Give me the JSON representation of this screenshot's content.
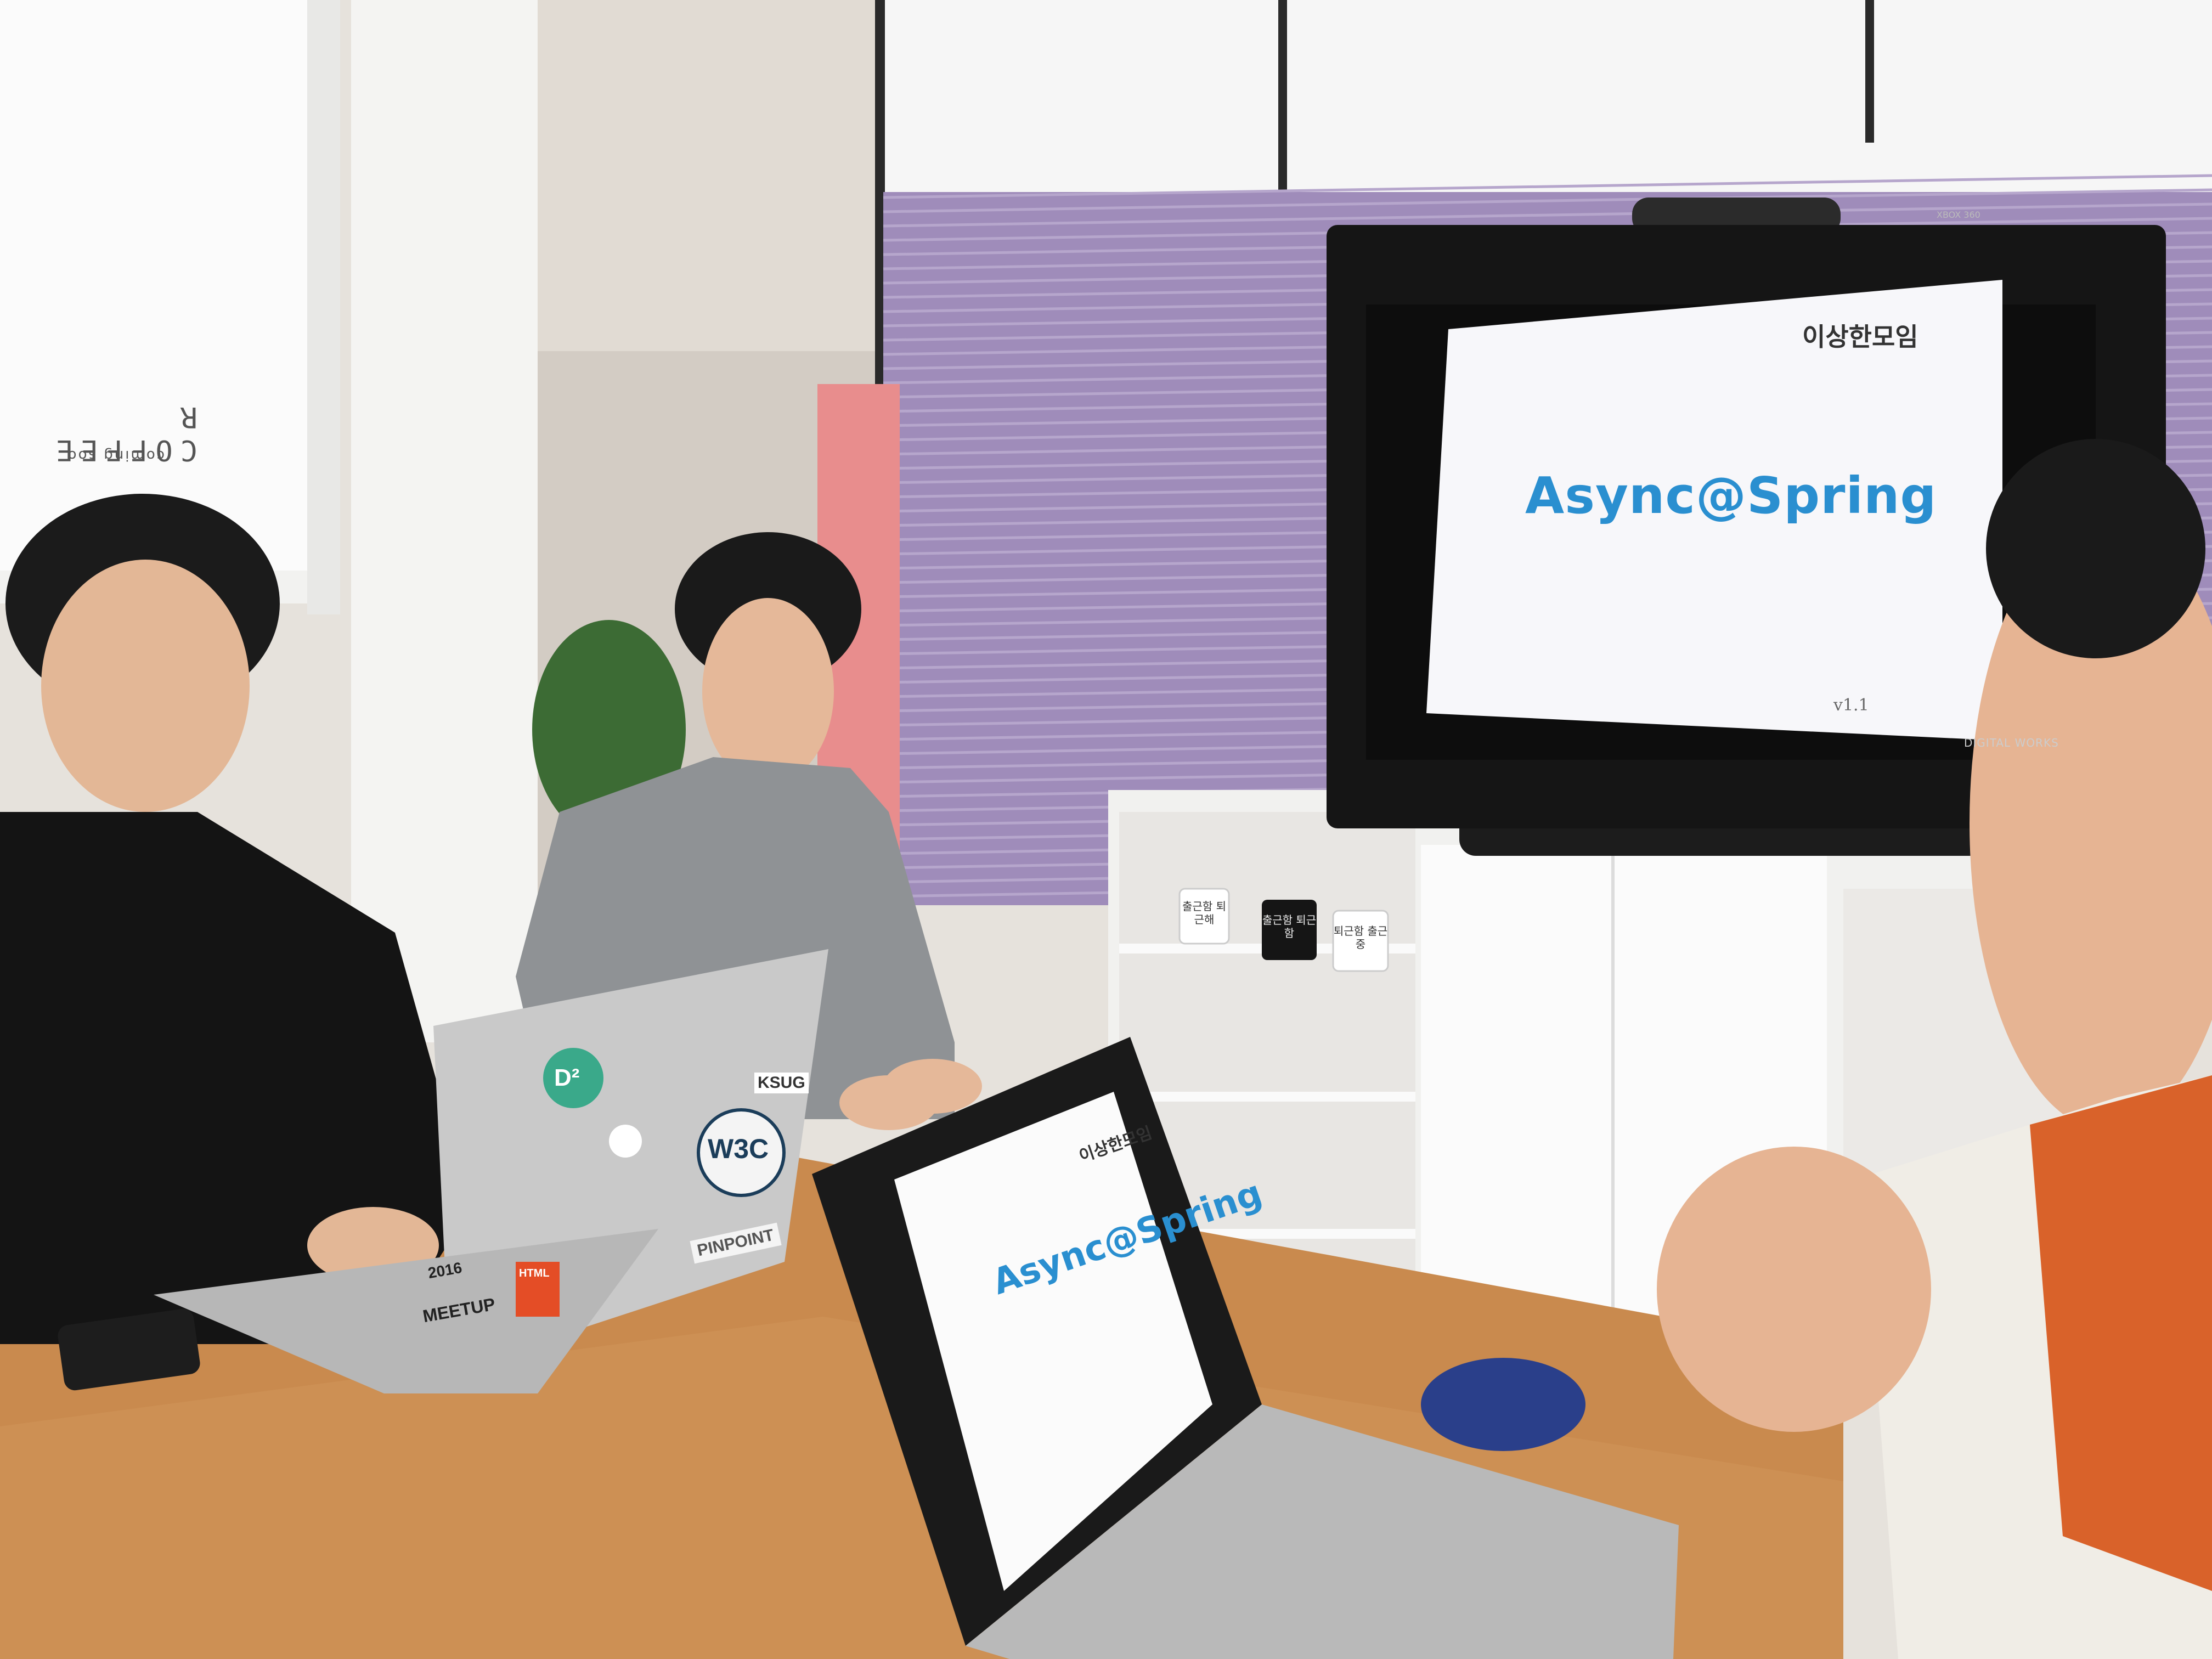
{
  "tv_slide": {
    "brand_logo_text": "이상한모임",
    "title": "Async@Spring",
    "version": "v1.1"
  },
  "tv_bezel": {
    "maker_label": "DIGITAL WORKS"
  },
  "sensor": {
    "label": "XBOX 360"
  },
  "cafe_sign": {
    "name": "COFFEE R",
    "subtitle": "coming soo"
  },
  "laptop_slide": {
    "brand_logo_text": "이상한모임",
    "title": "Async@Spring"
  },
  "mugs": [
    {
      "text": "출근함 퇴근해"
    },
    {
      "text": "출근함 퇴근함"
    },
    {
      "text": "퇴근함 출근중"
    }
  ],
  "stickers": {
    "d2": "D²",
    "ksug": "KSUG",
    "w3c": "W3C",
    "pinpoint": "PINPOINT",
    "meetup": "MEETUP",
    "year": "2016",
    "html": "HTML"
  },
  "colors": {
    "slide_title": "#2a8fd0",
    "wall_purple": "#9b88b8",
    "table_wood": "#c98a4e",
    "sweater_orange": "#d9622a"
  }
}
